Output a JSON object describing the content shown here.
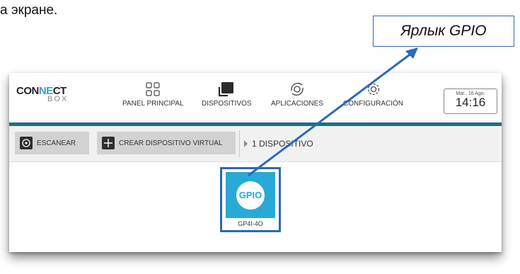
{
  "doc": {
    "text_fragment": "а экране."
  },
  "callout": {
    "label": "Ярлык GPIO"
  },
  "header": {
    "logo_top_part1": "CON",
    "logo_top_part2": "NE",
    "logo_top_part3": "CT",
    "logo_bottom": "BOX",
    "nav": [
      {
        "label": "PANEL PRINCIPAL",
        "icon": "grid-icon"
      },
      {
        "label": "DISPOSITIVOS",
        "icon": "devices-icon"
      },
      {
        "label": "APLICACIONES",
        "icon": "applications-icon"
      },
      {
        "label": "CONFIGURACIÓN",
        "icon": "settings-icon"
      }
    ],
    "date": "Mar., 16 Ago.",
    "time": "14:16"
  },
  "toolbar": {
    "scan_label": "ESCANEAR",
    "create_virtual_label": "CREAR DISPOSITIVO VIRTUAL",
    "device_count": "1 DISPOSITIVO"
  },
  "device": {
    "tile_text": "GPIO",
    "name": "GP4I-4O"
  },
  "colors": {
    "accent_teal": "#1f6e82",
    "tile_blue": "#29a9d6",
    "annotation_blue": "#2a69b8"
  }
}
